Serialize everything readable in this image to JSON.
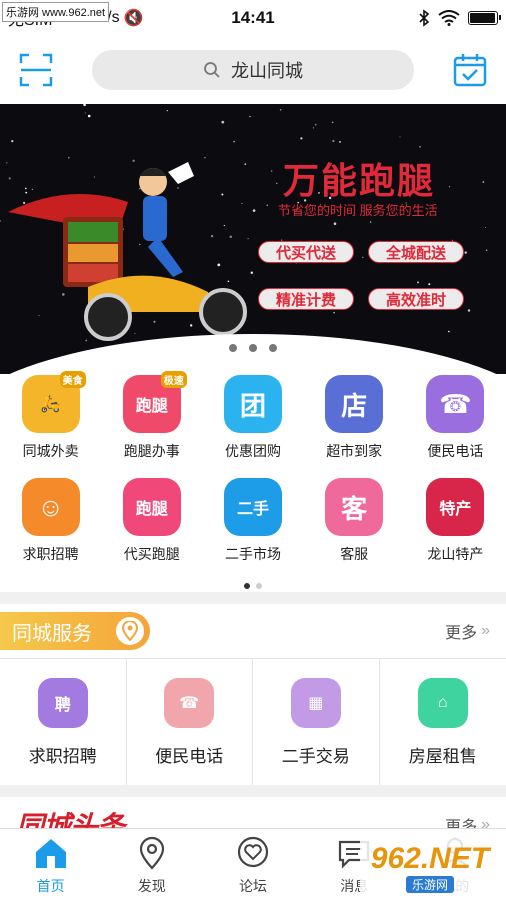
{
  "status_bar": {
    "carrier": "无SIM",
    "speed": "388.1K/s",
    "time": "14:41",
    "battery_level": 0.9
  },
  "watermark_top": "乐游网 www.962.net",
  "header": {
    "scan_icon": "scan-icon",
    "search_text": "龙山同城",
    "calendar_icon": "calendar-check-icon"
  },
  "banner": {
    "title": "万能跑腿",
    "subtitle": "节省您的时间 服务您的生活",
    "pills": [
      "代买代送",
      "全城配送",
      "精准计费",
      "高效准时"
    ],
    "slide_count": 3,
    "active_slide": 0
  },
  "categories": [
    {
      "label": "同城外卖",
      "color": "#f5b52a",
      "glyph": "🛵",
      "tag": "美食"
    },
    {
      "label": "跑腿办事",
      "color": "#f04a6a",
      "glyph": "跑腿",
      "tag": "极速"
    },
    {
      "label": "优惠团购",
      "color": "#2bb3ef",
      "glyph": "团",
      "tag": ""
    },
    {
      "label": "超市到家",
      "color": "#5a6fd6",
      "glyph": "店",
      "tag": ""
    },
    {
      "label": "便民电话",
      "color": "#9b6ee0",
      "glyph": "☎",
      "tag": ""
    },
    {
      "label": "求职招聘",
      "color": "#f58a2a",
      "glyph": "☺",
      "tag": ""
    },
    {
      "label": "代买跑腿",
      "color": "#f1487a",
      "glyph": "跑腿",
      "tag": ""
    },
    {
      "label": "二手市场",
      "color": "#1d9de8",
      "glyph": "二手",
      "tag": ""
    },
    {
      "label": "客服",
      "color": "#ef6a9a",
      "glyph": "客",
      "tag": ""
    },
    {
      "label": "龙山特产",
      "color": "#d8264a",
      "glyph": "特产",
      "tag": ""
    }
  ],
  "grid_pages": 2,
  "section_service": {
    "title": "同城服务",
    "more": "更多",
    "items": [
      {
        "label": "求职招聘",
        "color": "#a37be0",
        "glyph": "聘"
      },
      {
        "label": "便民电话",
        "color": "#f0a6ab",
        "glyph": "☎"
      },
      {
        "label": "二手交易",
        "color": "#c39ae6",
        "glyph": "▦"
      },
      {
        "label": "房屋租售",
        "color": "#3fd3a0",
        "glyph": "⌂"
      }
    ]
  },
  "section_news": {
    "title": "同城头条",
    "more": "更多"
  },
  "tabs": [
    {
      "label": "首页",
      "icon": "home-icon",
      "active": true
    },
    {
      "label": "发现",
      "icon": "location-pin-icon",
      "active": false
    },
    {
      "label": "论坛",
      "icon": "heart-chat-icon",
      "active": false
    },
    {
      "label": "消息",
      "icon": "message-icon",
      "active": false
    },
    {
      "label": "我的",
      "icon": "user-icon",
      "active": false
    }
  ],
  "watermark_bottom": {
    "big": "962.NET",
    "small": "乐游网"
  },
  "colors": {
    "accent": "#1a9ce8",
    "brand_red": "#e02a3a"
  }
}
